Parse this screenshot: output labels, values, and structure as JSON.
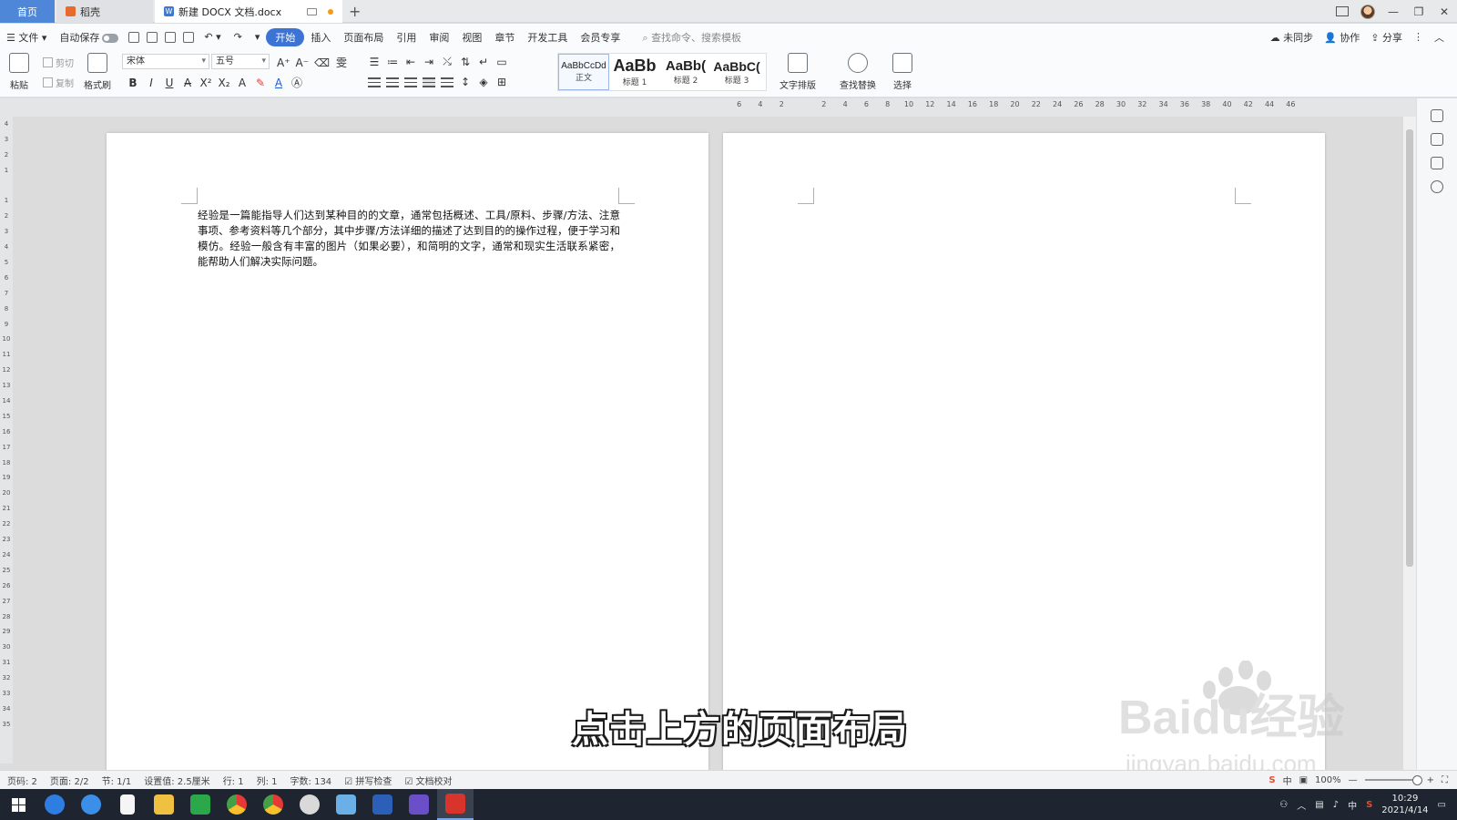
{
  "tabs": {
    "home": "首页",
    "daoke": "稻壳",
    "document": "新建 DOCX 文档.docx",
    "add": "+"
  },
  "menu": {
    "file": "文件",
    "autosave": "自动保存",
    "items": [
      "开始",
      "插入",
      "页面布局",
      "引用",
      "审阅",
      "视图",
      "章节",
      "开发工具",
      "会员专享"
    ],
    "search_placeholder": "查找命令、搜索模板",
    "sync": "未同步",
    "collab": "协作",
    "share": "分享"
  },
  "ribbon": {
    "paste": "粘贴",
    "cut": "剪切",
    "copy": "复制",
    "format_painter": "格式刷",
    "font_name": "宋体",
    "font_size": "五号",
    "styles": [
      {
        "sample": "AaBbCcDd",
        "label": "正文"
      },
      {
        "sample": "AaBb",
        "label": "标题 1"
      },
      {
        "sample": "AaBb(",
        "label": "标题 2"
      },
      {
        "sample": "AaBbC(",
        "label": "标题 3"
      }
    ],
    "text_layout": "文字排版",
    "find_replace": "查找替换",
    "select": "选择"
  },
  "ruler": {
    "horizontal": [
      "6",
      "4",
      "2",
      "",
      "2",
      "4",
      "6",
      "8",
      "10",
      "12",
      "14",
      "16",
      "18",
      "20",
      "22",
      "24",
      "26",
      "28",
      "30",
      "32",
      "34",
      "36",
      "38",
      "40",
      "42",
      "44",
      "46"
    ],
    "vertical": [
      "4",
      "3",
      "2",
      "1",
      "",
      "1",
      "2",
      "3",
      "4",
      "5",
      "6",
      "7",
      "8",
      "9",
      "10",
      "11",
      "12",
      "13",
      "14",
      "15",
      "16",
      "17",
      "18",
      "19",
      "20",
      "21",
      "22",
      "23",
      "24",
      "25",
      "26",
      "27",
      "28",
      "29",
      "30",
      "31",
      "32",
      "33",
      "34",
      "35"
    ]
  },
  "document": {
    "body_text": "经验是一篇能指导人们达到某种目的的文章，通常包括概述、工具/原料、步骤/方法、注意事项、参考资料等几个部分，其中步骤/方法详细的描述了达到目的的操作过程，便于学习和模仿。经验一般含有丰富的图片（如果必要），和简明的文字，通常和现实生活联系紧密，能帮助人们解决实际问题。"
  },
  "overlay": {
    "subtitle": "点击上方的页面布局",
    "watermark_text": "Baidu经验",
    "watermark_url": "jingyan.baidu.com"
  },
  "status": {
    "page_num": "页码: 2",
    "pages": "页面: 2/2",
    "section": "节: 1/1",
    "setting": "设置值: 2.5厘米",
    "row": "行: 1",
    "col": "列: 1",
    "word_count": "字数: 134",
    "spell_check": "拼写检查",
    "doc_check": "文档校对",
    "zoom": "100%"
  },
  "taskbar": {
    "time": "10:29",
    "date": "2021/4/14",
    "ime": "中"
  }
}
